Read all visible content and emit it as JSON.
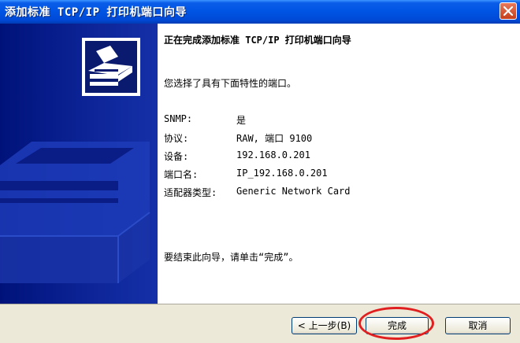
{
  "window": {
    "title": "添加标准 TCP/IP 打印机端口向导",
    "close_icon": "close-icon"
  },
  "side_panel": {
    "illustration_icon": "printer-illustration"
  },
  "main": {
    "heading": "正在完成添加标准 TCP/IP 打印机端口向导",
    "intro": "您选择了具有下面特性的端口。",
    "details": [
      {
        "label": "SNMP:",
        "value": "是"
      },
      {
        "label": "协议:",
        "value": "RAW, 端口 9100"
      },
      {
        "label": "设备:",
        "value": "192.168.0.201"
      },
      {
        "label": "端口名:",
        "value": "IP_192.168.0.201"
      },
      {
        "label": "适配器类型:",
        "value": "Generic Network Card"
      }
    ],
    "footer": "要结束此向导，请单击“完成”。"
  },
  "buttons": {
    "back_label": "< 上一步(B)",
    "finish_label": "完成",
    "cancel_label": "取消"
  },
  "colors": {
    "title_bar": "#0054e3",
    "side_panel": "#0b2294",
    "highlight": "#e02020",
    "button_bar": "#ece9d8"
  }
}
